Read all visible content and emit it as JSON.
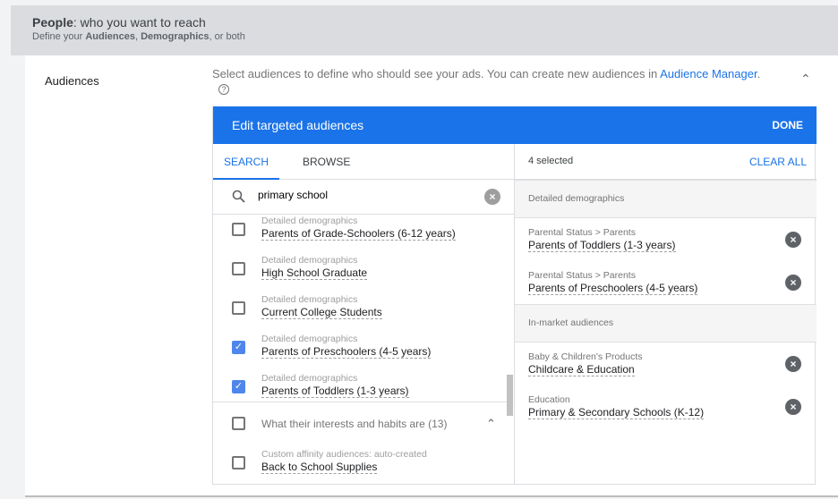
{
  "header": {
    "title_bold": "People",
    "title_rest": ": who you want to reach",
    "sub_pre": "Define your ",
    "sub_b1": "Audiences",
    "sub_mid": ", ",
    "sub_b2": "Demographics",
    "sub_post": ", or both"
  },
  "audiences": {
    "label": "Audiences",
    "desc": "Select audiences to define who should see your ads.  You can create new audiences in ",
    "link": "Audience Manager",
    "period": ".",
    "help": "?"
  },
  "editor": {
    "title": "Edit targeted audiences",
    "done": "DONE",
    "tabs": [
      "SEARCH",
      "BROWSE"
    ],
    "active_tab": "SEARCH",
    "search_value": "primary school",
    "results": [
      {
        "category": "Detailed demographics",
        "name": "Parents of Grade-Schoolers (6-12 years)",
        "checked": false
      },
      {
        "category": "Detailed demographics",
        "name": "High School Graduate",
        "checked": false
      },
      {
        "category": "Detailed demographics",
        "name": "Current College Students",
        "checked": false
      },
      {
        "category": "Detailed demographics",
        "name": "Parents of Preschoolers (4-5 years)",
        "checked": true
      },
      {
        "category": "Detailed demographics",
        "name": "Parents of Toddlers (1-3 years)",
        "checked": true
      }
    ],
    "group": {
      "label": "What their interests and habits are (13)",
      "checked": false
    },
    "group_items": [
      {
        "category": "Custom affinity audiences: auto-created",
        "name": "Back to School Supplies",
        "checked": false
      }
    ],
    "selected_count": "4 selected",
    "clear_all": "CLEAR ALL",
    "sections": [
      {
        "title": "Detailed demographics",
        "items": [
          {
            "category": "Parental Status > Parents",
            "name": "Parents of Toddlers (1-3 years)"
          },
          {
            "category": "Parental Status > Parents",
            "name": "Parents of Preschoolers (4-5 years)"
          }
        ]
      },
      {
        "title": "In-market audiences",
        "items": [
          {
            "category": "Baby & Children's Products",
            "name": "Childcare & Education"
          },
          {
            "category": "Education",
            "name": "Primary & Secondary Schools (K-12)"
          }
        ]
      }
    ]
  },
  "colors": {
    "accent": "#1a73e8",
    "checkbox": "#4f86ec"
  }
}
